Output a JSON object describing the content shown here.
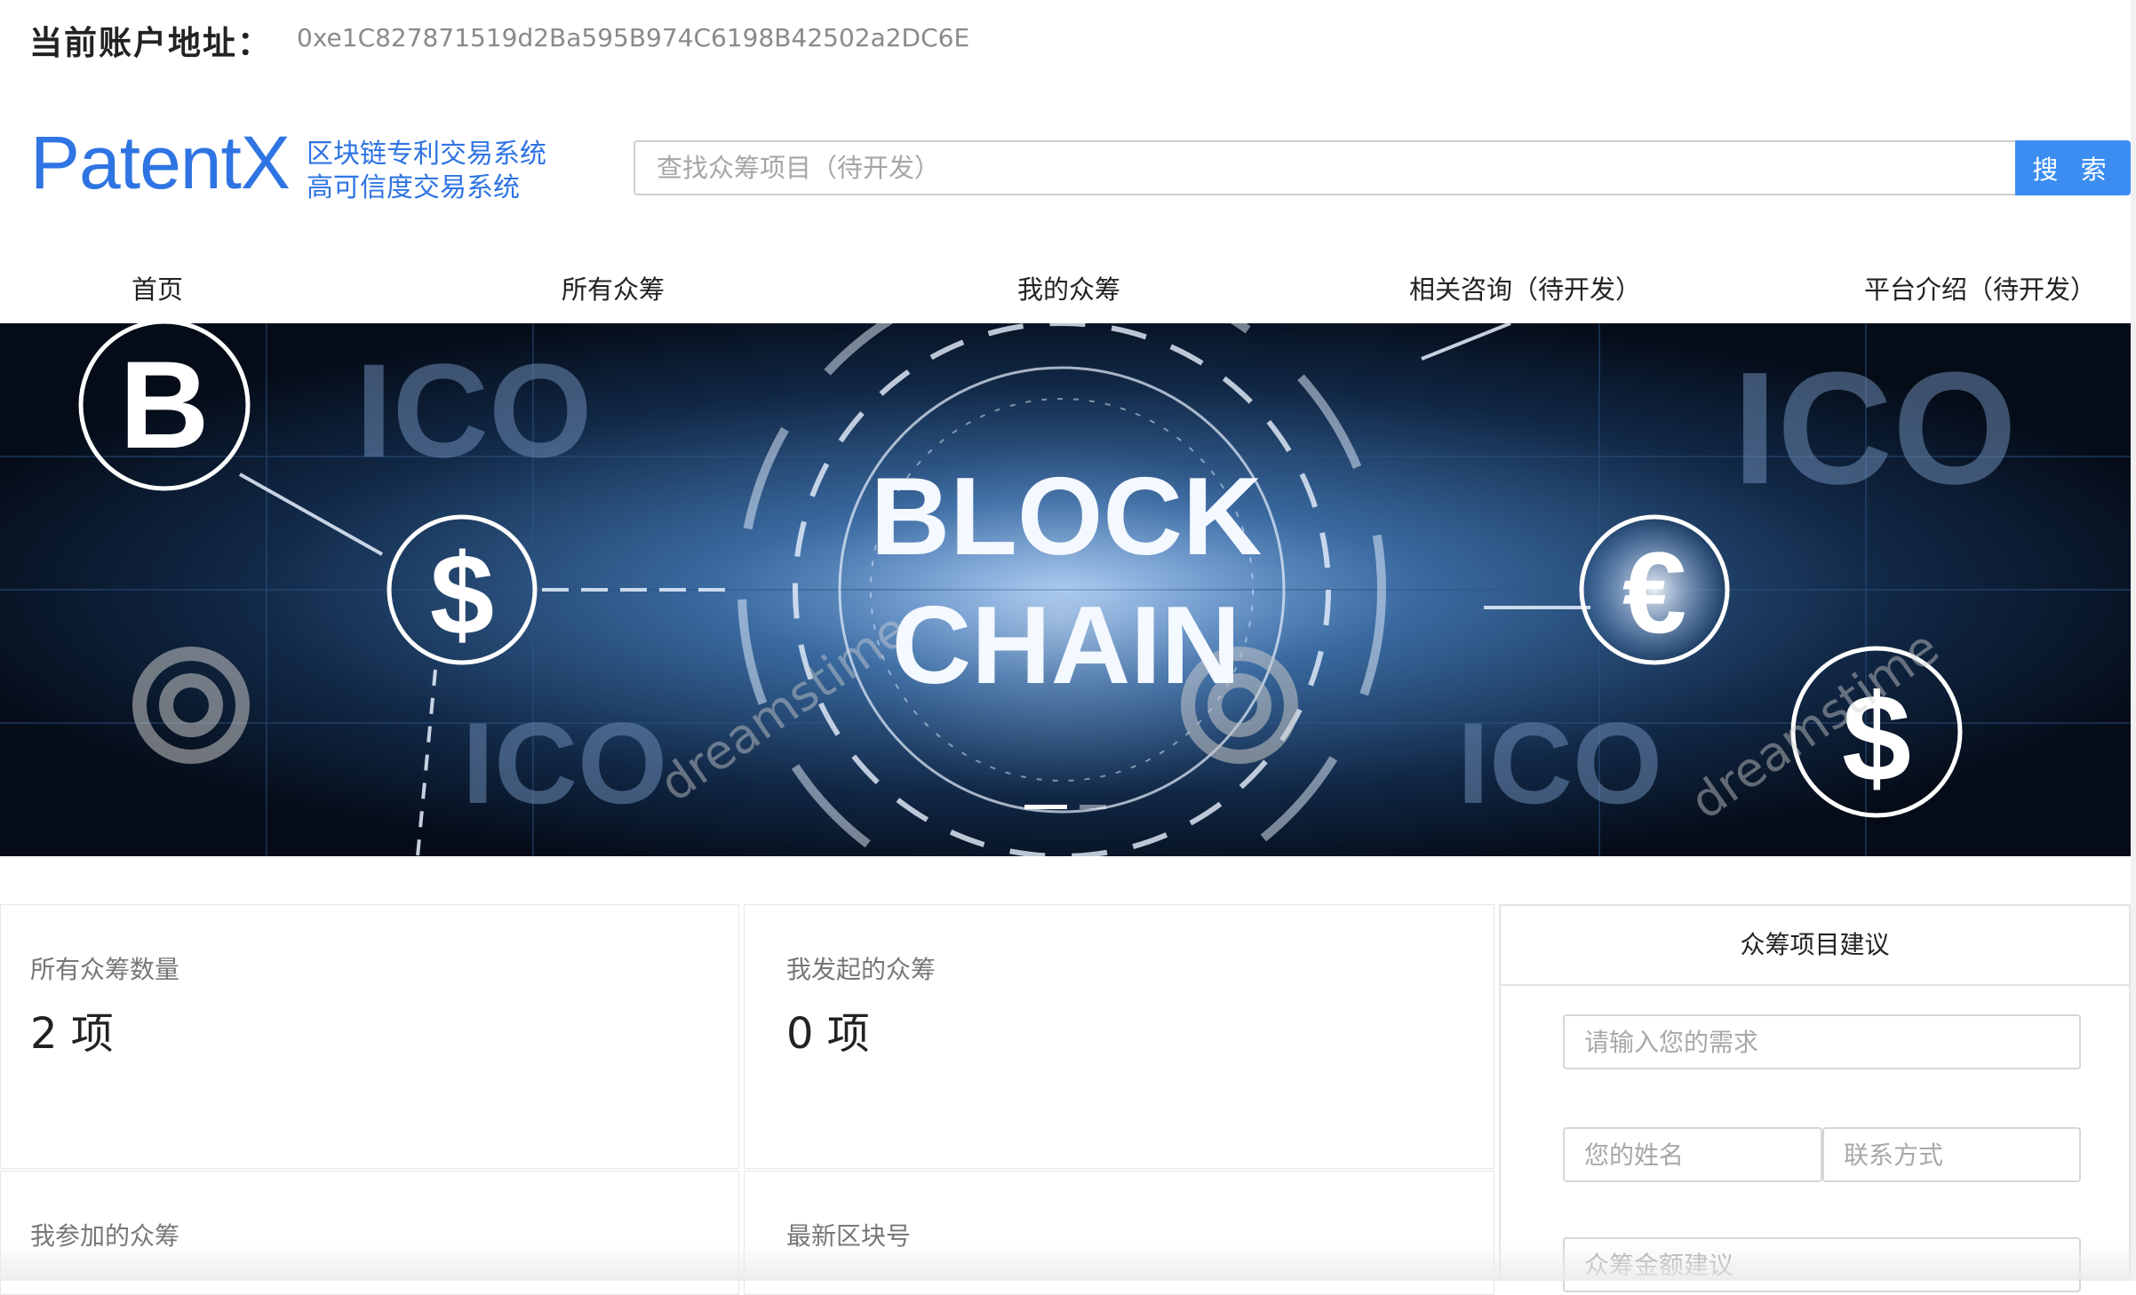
{
  "account": {
    "label": "当前账户地址：",
    "address": "0xe1C827871519d2Ba595B974C6198B42502a2DC6E"
  },
  "logo": {
    "brand": "PatentX",
    "subtitle_1": "区块链专利交易系统",
    "subtitle_2": "高可信度交易系统"
  },
  "search": {
    "placeholder": "查找众筹项目（待开发）",
    "value": "",
    "button_label": "搜 索"
  },
  "nav": {
    "items": [
      {
        "label": "首页"
      },
      {
        "label": "所有众筹"
      },
      {
        "label": "我的众筹"
      },
      {
        "label": "相关咨询（待开发）"
      },
      {
        "label": "平台介绍（待开发）"
      }
    ]
  },
  "banner": {
    "headline_1": "BLOCK",
    "headline_2": "CHAIN",
    "ico_text": "ICO",
    "symbols": {
      "bitcoin": "B",
      "dollar": "$",
      "euro": "€"
    },
    "watermark": "dreamstime",
    "carousel_active_index": 0,
    "carousel_count": 2
  },
  "stats": {
    "all_crowdfunding": {
      "title": "所有众筹数量",
      "value": "2 项"
    },
    "my_initiated": {
      "title": "我发起的众筹",
      "value": "0 项"
    },
    "my_joined": {
      "title": "我参加的众筹"
    },
    "latest_block": {
      "title": "最新区块号"
    }
  },
  "suggestion": {
    "title": "众筹项目建议",
    "need_placeholder": "请输入您的需求",
    "name_placeholder": "您的姓名",
    "contact_placeholder": "联系方式",
    "amount_placeholder": "众筹金额建议"
  },
  "colors": {
    "brand_blue": "#2f74e3",
    "button_blue": "#3b8df2",
    "banner_bg": "#071426"
  }
}
